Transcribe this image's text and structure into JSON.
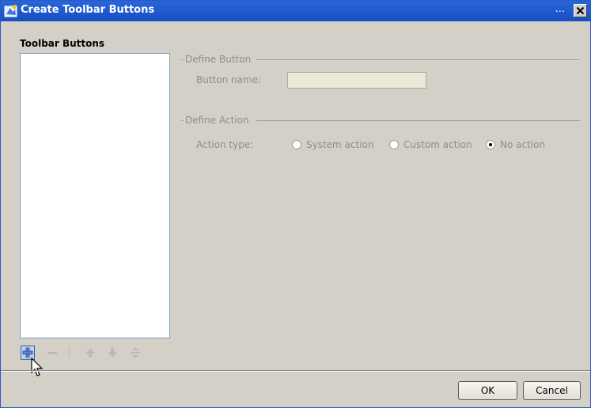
{
  "window": {
    "title": "Create Toolbar Buttons",
    "title_dots": "...",
    "accent_color": "#1f5bd1"
  },
  "left_panel": {
    "title": "Toolbar Buttons",
    "toolbar_icons": [
      "add-icon",
      "remove-icon",
      "move-up-icon",
      "move-down-icon",
      "separator-icon"
    ]
  },
  "define_button": {
    "group_label": "Define Button",
    "name_label": "Button name:",
    "name_value": ""
  },
  "define_action": {
    "group_label": "Define Action",
    "type_label": "Action type:",
    "options": [
      {
        "label": "System action",
        "selected": false
      },
      {
        "label": "Custom action",
        "selected": false
      },
      {
        "label": "No action",
        "selected": true
      }
    ]
  },
  "footer": {
    "ok_label": "OK",
    "cancel_label": "Cancel"
  }
}
